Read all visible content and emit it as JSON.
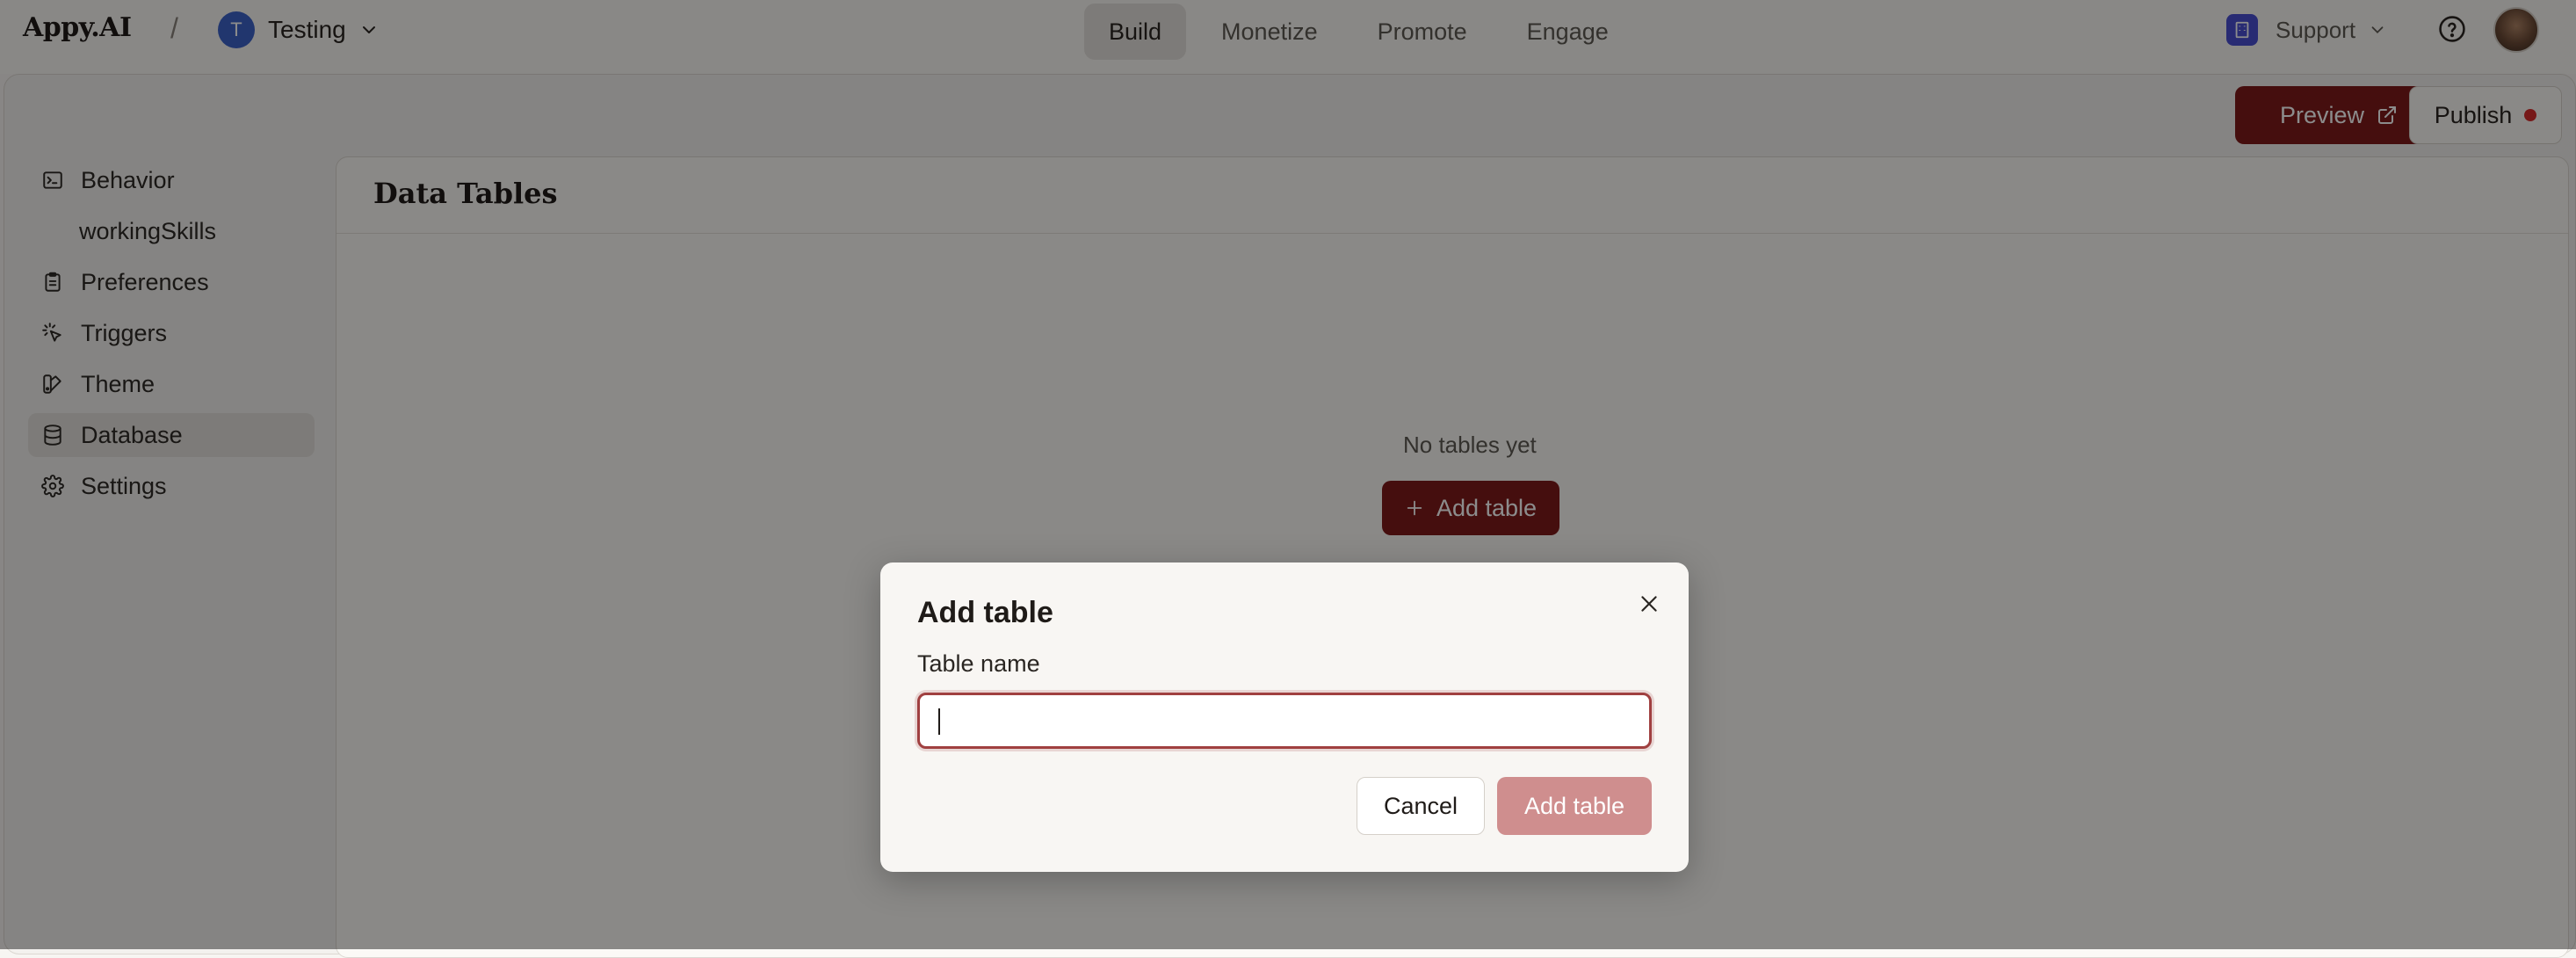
{
  "app": {
    "logo": "Appy.AI",
    "separator": "/"
  },
  "project": {
    "initial": "T",
    "name": "Testing",
    "avatar_color": "#3d63c9"
  },
  "nav": {
    "tabs": [
      {
        "label": "Build",
        "active": true
      },
      {
        "label": "Monetize",
        "active": false
      },
      {
        "label": "Promote",
        "active": false
      },
      {
        "label": "Engage",
        "active": false
      }
    ]
  },
  "header_right": {
    "support_label": "Support",
    "support_icon_color": "#4a4fd1"
  },
  "actions": {
    "preview_label": "Preview",
    "publish_label": "Publish",
    "publish_status_color": "#d82c2c"
  },
  "sidebar": {
    "items": [
      {
        "label": "Behavior",
        "icon": "terminal-icon",
        "active": false
      },
      {
        "label": "workingSkills",
        "icon": "",
        "active": false,
        "sub": true
      },
      {
        "label": "Preferences",
        "icon": "clipboard-icon",
        "active": false
      },
      {
        "label": "Triggers",
        "icon": "sparkle-click-icon",
        "active": false
      },
      {
        "label": "Theme",
        "icon": "palette-icon",
        "active": false
      },
      {
        "label": "Database",
        "icon": "database-icon",
        "active": true
      },
      {
        "label": "Settings",
        "icon": "gear-icon",
        "active": false
      }
    ]
  },
  "main": {
    "title": "Data Tables",
    "empty_text": "No tables yet",
    "add_button_label": "Add table"
  },
  "modal": {
    "title": "Add table",
    "field_label": "Table name",
    "field_value": "",
    "cancel_label": "Cancel",
    "submit_label": "Add table"
  },
  "colors": {
    "brand": "#7f1a1a",
    "brand_disabled": "#cf8e8e",
    "background": "#f7f5f2"
  }
}
